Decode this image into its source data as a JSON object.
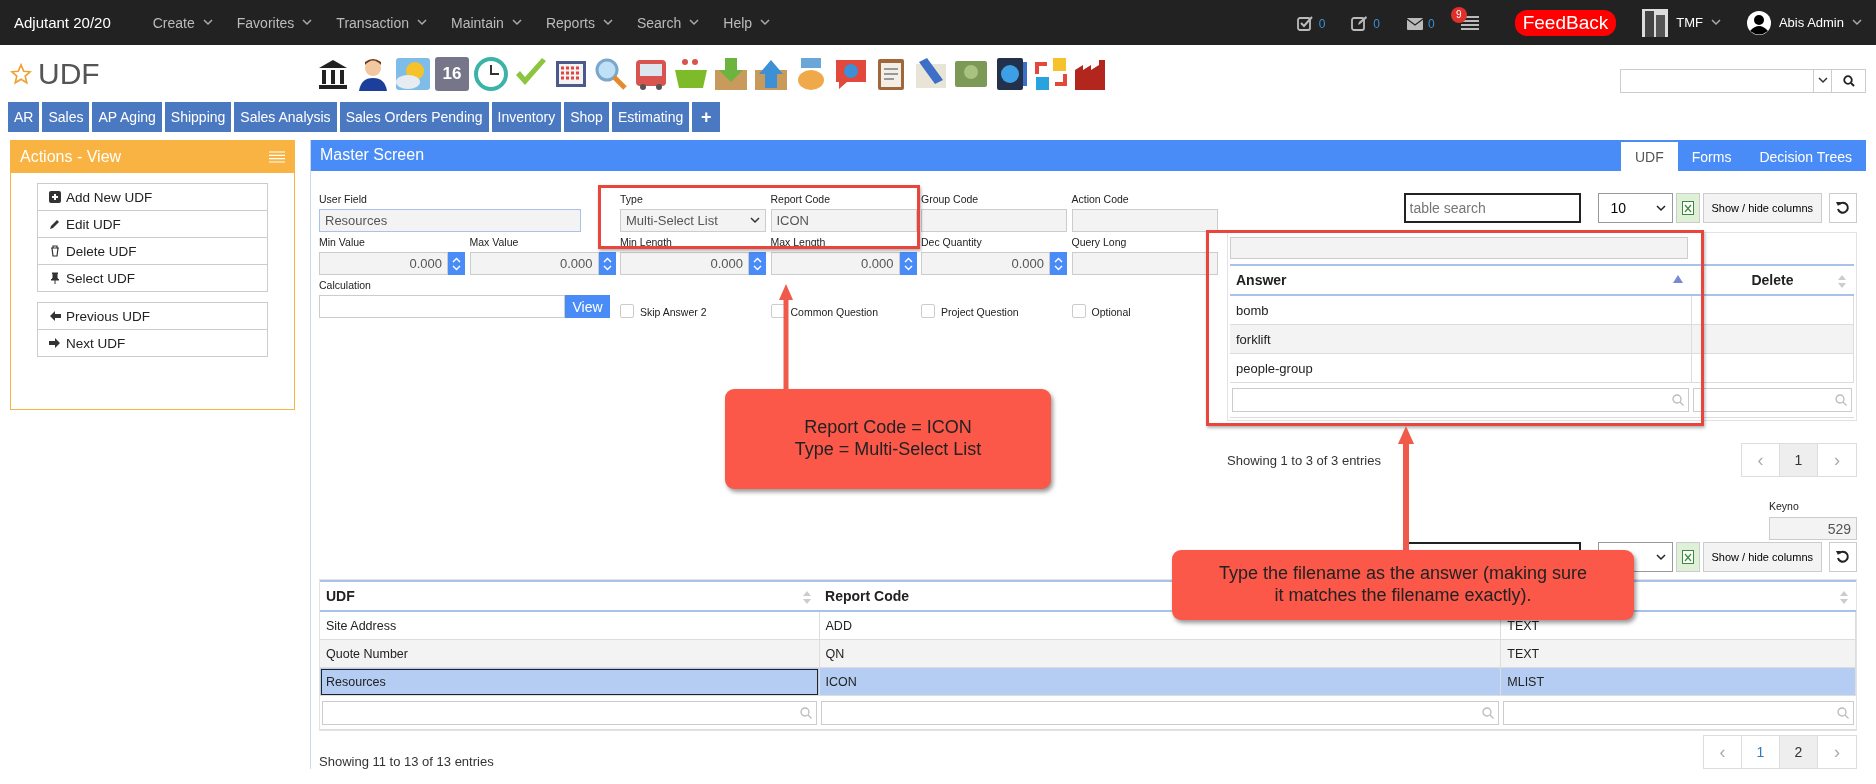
{
  "top_bar": {
    "brand": "Adjutant 20/20",
    "menu": [
      "Create",
      "Favorites",
      "Transaction",
      "Maintain",
      "Reports",
      "Search",
      "Help"
    ],
    "counters": [
      {
        "kind": "tasks",
        "count": "0"
      },
      {
        "kind": "notes",
        "count": "0"
      },
      {
        "kind": "mail",
        "count": "0"
      }
    ],
    "alerts_badge": "9",
    "feedback": "FeedBack",
    "company": "TMF",
    "user": "Abis Admin"
  },
  "page": {
    "title": "UDF",
    "calendar_day": "16"
  },
  "quick_tabs": [
    "AR",
    "Sales",
    "AP Aging",
    "Shipping",
    "Sales Analysis",
    "Sales Orders Pending",
    "Inventory",
    "Shop",
    "Estimating"
  ],
  "add_tab": "+",
  "actions": {
    "title": "Actions - View",
    "groups": [
      [
        {
          "kind": "add",
          "label": "Add New UDF"
        },
        {
          "kind": "edit",
          "label": "Edit UDF"
        },
        {
          "kind": "delete",
          "label": "Delete UDF"
        },
        {
          "kind": "pin",
          "label": "Select UDF"
        }
      ],
      [
        {
          "kind": "prev",
          "label": "Previous UDF"
        },
        {
          "kind": "next",
          "label": "Next UDF"
        }
      ]
    ]
  },
  "master": {
    "title": "Master Screen",
    "tabs": [
      {
        "label": "UDF",
        "selected": true
      },
      {
        "label": "Forms",
        "selected": false
      },
      {
        "label": "Decision Trees",
        "selected": false
      }
    ],
    "fields": [
      {
        "kind": "long_text",
        "label": "User Field",
        "value": "Resources"
      },
      {
        "kind": "select",
        "label": "Type",
        "value": "Multi-Select List"
      },
      {
        "kind": "text",
        "label": "Report Code",
        "value": "ICON"
      },
      {
        "kind": "text",
        "label": "Group Code"
      },
      {
        "kind": "text",
        "label": "Action Code"
      }
    ],
    "numeric_fields": [
      {
        "kind": "number",
        "label": "Min Value",
        "value": "0.000"
      },
      {
        "kind": "number",
        "label": "Max Value",
        "value": "0.000"
      },
      {
        "kind": "number",
        "label": "Min Length",
        "value": "0.000"
      },
      {
        "kind": "number",
        "label": "Max Length",
        "value": "0.000"
      },
      {
        "kind": "number",
        "label": "Dec Quantity",
        "value": "0.000"
      },
      {
        "kind": "text",
        "label": "Query Long"
      }
    ],
    "calculation": {
      "label": "Calculation",
      "button": "View"
    },
    "options": [
      {
        "label": "Skip Answer 2",
        "checked": false
      },
      {
        "label": "Common Question",
        "checked": false
      },
      {
        "label": "Project Question",
        "checked": false
      },
      {
        "label": "Optional",
        "checked": false
      }
    ]
  },
  "answers": {
    "search_placeholder": "table search",
    "page_size": "10",
    "columns_button": "Show / hide columns",
    "columns": [
      "Answer",
      "Delete"
    ],
    "rows": [
      {
        "answer": "bomb"
      },
      {
        "answer": "forklift"
      },
      {
        "answer": "people-group"
      }
    ],
    "info": "Showing 1 to 3 of 3 entries",
    "prev": "‹",
    "next": "›",
    "pages": [
      {
        "label": "1",
        "selected": true
      }
    ]
  },
  "keyno": {
    "label": "Keyno",
    "value": "529"
  },
  "udf_table": {
    "columns_button": "Show / hide columns",
    "columns": [
      "UDF",
      "Report Code"
    ],
    "rows": [
      {
        "udf": "Site Address",
        "report_code": "ADD",
        "column_3": "TEXT",
        "selected": false
      },
      {
        "udf": "Quote Number",
        "report_code": "QN",
        "column_3": "TEXT",
        "selected": false
      },
      {
        "udf": "Resources",
        "report_code": "ICON",
        "column_3": "MLIST",
        "selected": true
      }
    ],
    "info": "Showing 11 to 13 of 13 entries",
    "prev": "‹",
    "next": "›",
    "pages": [
      {
        "label": "1",
        "selected": false
      },
      {
        "label": "2",
        "selected": true
      }
    ]
  },
  "callouts": [
    {
      "lines": [
        "Report Code = ICON",
        "Type = Multi-Select List"
      ]
    },
    {
      "lines": [
        "Type the filename as the answer (making sure",
        "it matches the filename exactly)."
      ]
    }
  ]
}
